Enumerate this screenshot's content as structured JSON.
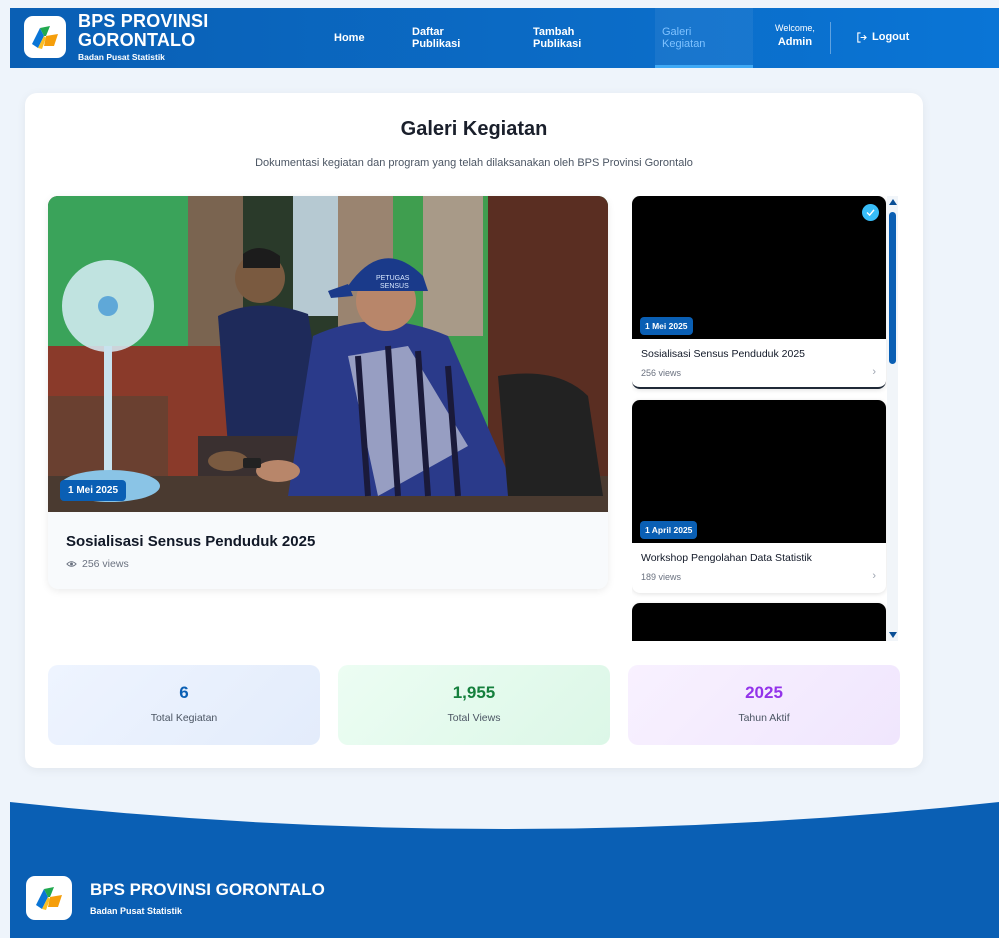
{
  "header": {
    "brand_title_line1": "BPS PROVINSI",
    "brand_title_line2": "GORONTALO",
    "brand_subtitle": "Badan Pusat Statistik",
    "nav": [
      {
        "label_line1": "Home",
        "label_line2": ""
      },
      {
        "label_line1": "Daftar",
        "label_line2": "Publikasi"
      },
      {
        "label_line1": "Tambah",
        "label_line2": "Publikasi"
      },
      {
        "label_line1": "Galeri",
        "label_line2": "Kegiatan"
      }
    ],
    "welcome_text": "Welcome,",
    "user_name": "Admin",
    "logout_label": "Logout"
  },
  "page": {
    "title": "Galeri Kegiatan",
    "subtitle": "Dokumentasi kegiatan dan program yang telah dilaksanakan oleh BPS Provinsi Gorontalo"
  },
  "featured": {
    "date": "1 Mei 2025",
    "title": "Sosialisasi Sensus Penduduk 2025",
    "views": "256 views",
    "cap_text_line1": "PETUGAS",
    "cap_text_line2": "SENSUS"
  },
  "gallery_items": [
    {
      "date": "1 Mei 2025",
      "title": "Sosialisasi Sensus Penduduk 2025",
      "views": "256 views"
    },
    {
      "date": "1 April 2025",
      "title": "Workshop Pengolahan Data Statistik",
      "views": "189 views"
    }
  ],
  "stats": [
    {
      "value": "6",
      "label": "Total Kegiatan"
    },
    {
      "value": "1,955",
      "label": "Total Views"
    },
    {
      "value": "2025",
      "label": "Tahun Aktif"
    }
  ],
  "footer": {
    "title": "BPS PROVINSI GORONTALO",
    "subtitle": "Badan Pusat Statistik"
  },
  "colors": {
    "primary": "#0a5fb4",
    "views_green": "#15803d",
    "year_purple": "#9333ea",
    "active_nav": "#7fc2ff"
  },
  "icons": [
    "bps-logo-icon",
    "logout-icon",
    "eye-icon",
    "check-icon",
    "chevron-right-icon",
    "scroll-up-arrow",
    "scroll-down-arrow"
  ]
}
